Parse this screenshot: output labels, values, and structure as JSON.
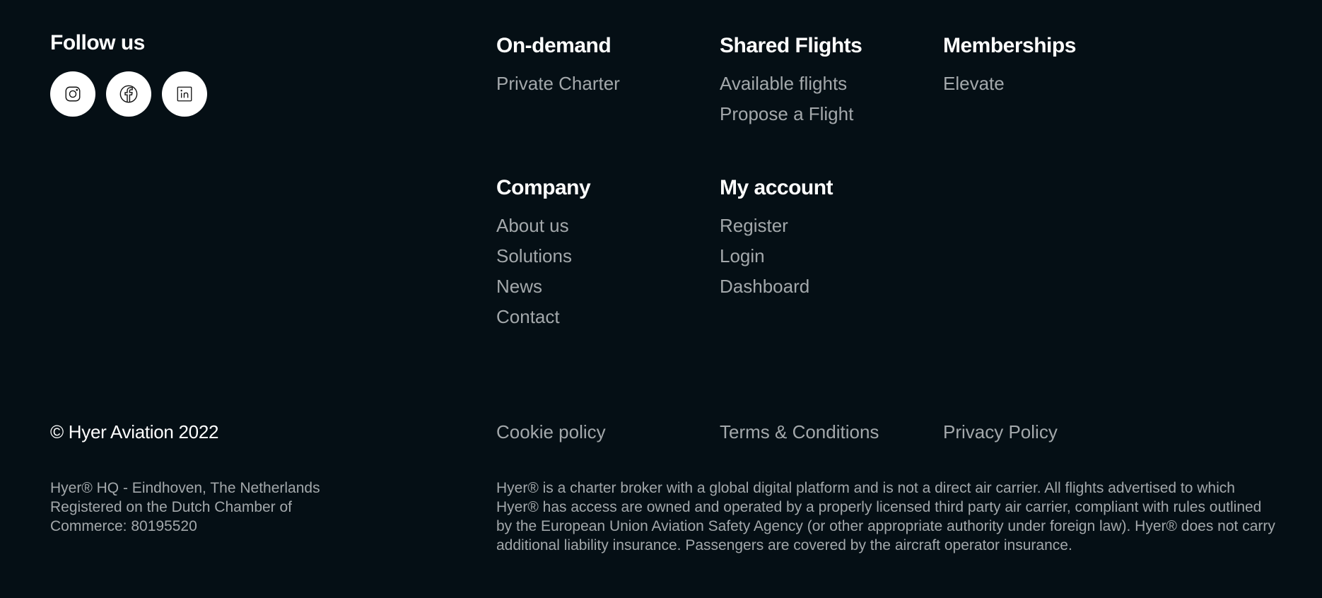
{
  "follow": {
    "title": "Follow us",
    "socials": [
      {
        "name": "Instagram",
        "icon": "instagram-icon"
      },
      {
        "name": "Facebook",
        "icon": "facebook-icon"
      },
      {
        "name": "LinkedIn",
        "icon": "linkedin-icon"
      }
    ]
  },
  "nav": {
    "ondemand": {
      "title": "On-demand",
      "items": [
        "Private Charter"
      ]
    },
    "shared": {
      "title": "Shared Flights",
      "items": [
        "Available flights",
        "Propose a Flight"
      ]
    },
    "memberships": {
      "title": "Memberships",
      "items": [
        "Elevate"
      ]
    },
    "company": {
      "title": "Company",
      "items": [
        "About us",
        "Solutions",
        "News",
        "Contact"
      ]
    },
    "account": {
      "title": "My account",
      "items": [
        "Register",
        "Login",
        "Dashboard"
      ]
    }
  },
  "footer": {
    "copyright": "© Hyer Aviation 2022",
    "cookie": "Cookie policy",
    "terms": "Terms & Conditions",
    "privacy": "Privacy Policy",
    "hq_lines": [
      "Hyer® HQ - Eindhoven, The Netherlands",
      "Registered on the Dutch Chamber of",
      "Commerce: 80195520"
    ],
    "disclaimer": "Hyer® is a charter broker with a global digital platform and is not a direct air carrier. All flights advertised to which Hyer® has access are owned and operated by a properly licensed third party air carrier, compliant with rules outlined by the European Union Aviation Safety Agency (or other appropriate authority under foreign law). Hyer® does not carry additional liability insurance. Passengers are covered by the aircraft operator insurance."
  },
  "colors": {
    "background": "#050f15",
    "heading": "#ffffff",
    "link": "#a3a8ab"
  }
}
